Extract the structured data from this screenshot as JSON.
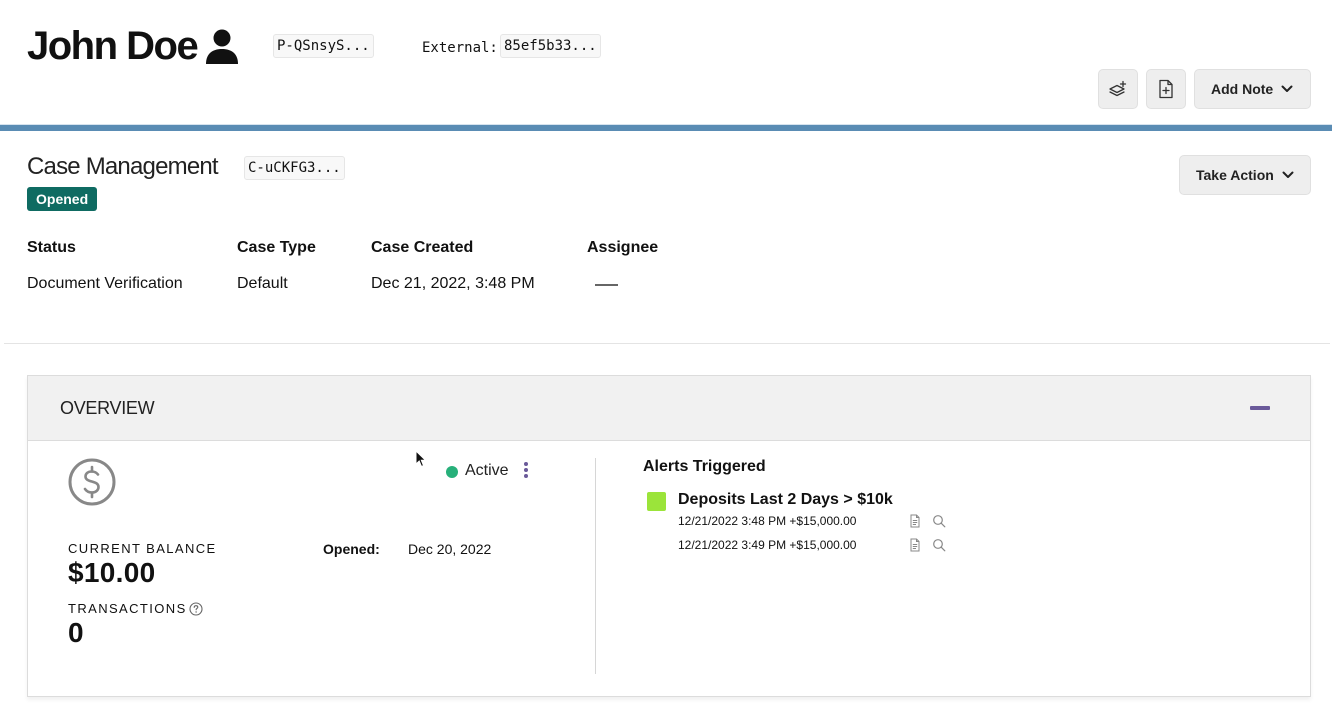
{
  "header": {
    "name": "John Doe",
    "person_id": "P-QSnsyS...",
    "external_label": "External:",
    "external_id": "85ef5b33...",
    "add_note_label": "Add Note",
    "icons": [
      "person-icon",
      "layers-plus-icon",
      "document-plus-icon",
      "chevron-down-icon"
    ]
  },
  "case": {
    "title": "Case Management",
    "case_id": "C-uCKFG3...",
    "status_badge": "Opened",
    "take_action_label": "Take Action",
    "fields": [
      {
        "label": "Status",
        "value": "Document Verification"
      },
      {
        "label": "Case Type",
        "value": "Default"
      },
      {
        "label": "Case Created",
        "value": "Dec 21, 2022, 3:48 PM"
      },
      {
        "label": "Assignee",
        "value": ""
      }
    ]
  },
  "overview": {
    "title": "OVERVIEW",
    "account": {
      "status": "Active",
      "balance_label": "CURRENT BALANCE",
      "balance": "$10.00",
      "transactions_label": "TRANSACTIONS",
      "transactions": "0",
      "opened_label": "Opened:",
      "opened_value": "Dec 20, 2022"
    },
    "alerts": {
      "title": "Alerts Triggered",
      "items": [
        {
          "name": "Deposits Last 2 Days > $10k",
          "rows": [
            "12/21/2022 3:48 PM +$15,000.00",
            "12/21/2022 3:49 PM +$15,000.00"
          ]
        }
      ]
    }
  },
  "colors": {
    "accent_bar": "#5a8cb4",
    "badge": "#0f6b62",
    "active": "#27b07a",
    "alert": "#9be43a",
    "purple": "#6a5a9a"
  }
}
